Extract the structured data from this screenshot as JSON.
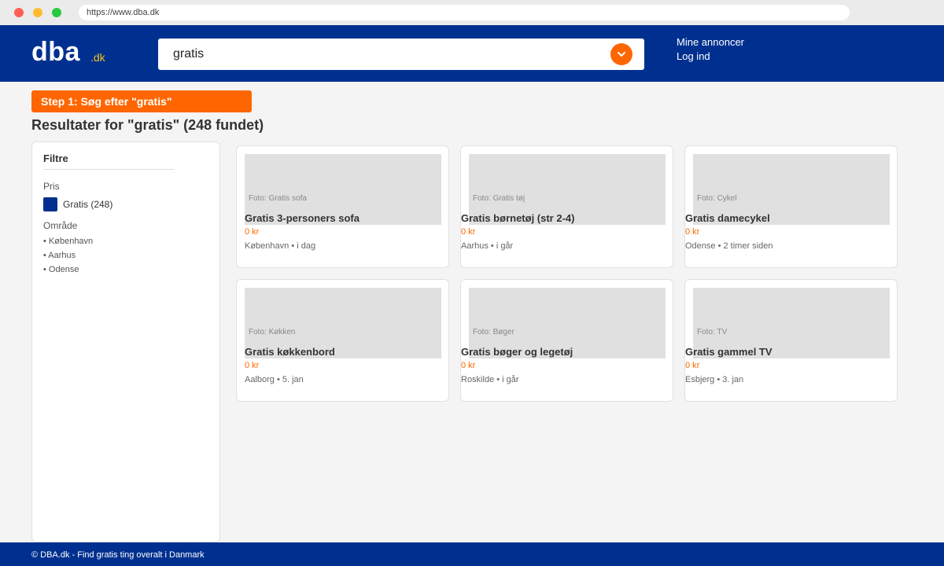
{
  "browser": {
    "url": "https://www.dba.dk"
  },
  "header": {
    "logo": "dba",
    "logo_suffix": ".dk",
    "search_value": "gratis",
    "nav": [
      "Mine annoncer",
      "Log ind"
    ]
  },
  "step_banner": "Step 1: Søg efter \"gratis\"",
  "results_title": "Resultater for \"gratis\" (248 fundet)",
  "sidebar": {
    "title": "Filtre",
    "price_label": "Pris",
    "price_option": "Gratis (248)",
    "area_label": "Område",
    "areas": [
      "• København",
      "• Aarhus",
      "• Odense"
    ]
  },
  "listings": [
    {
      "photo": "Foto: Gratis sofa",
      "title": "Gratis 3-personers sofa",
      "price": "0 kr",
      "meta": "København • i dag"
    },
    {
      "photo": "Foto: Gratis tøj",
      "title": "Gratis børnetøj (str 2-4)",
      "price": "0 kr",
      "meta": "Aarhus • i går"
    },
    {
      "photo": "Foto: Cykel",
      "title": "Gratis damecykel",
      "price": "0 kr",
      "meta": "Odense • 2 timer siden"
    },
    {
      "photo": "Foto: Køkken",
      "title": "Gratis køkkenbord",
      "price": "0 kr",
      "meta": "Aalborg • 5. jan"
    },
    {
      "photo": "Foto: Bøger",
      "title": "Gratis bøger og legetøj",
      "price": "0 kr",
      "meta": "Roskilde • i går"
    },
    {
      "photo": "Foto: TV",
      "title": "Gratis gammel TV",
      "price": "0 kr",
      "meta": "Esbjerg • 3. jan"
    }
  ],
  "footer": "© DBA.dk - Find gratis ting overalt i Danmark",
  "colors": {
    "brand_blue": "#00308f",
    "accent_orange": "#ff6600",
    "logo_yellow": "#f4c21a"
  }
}
